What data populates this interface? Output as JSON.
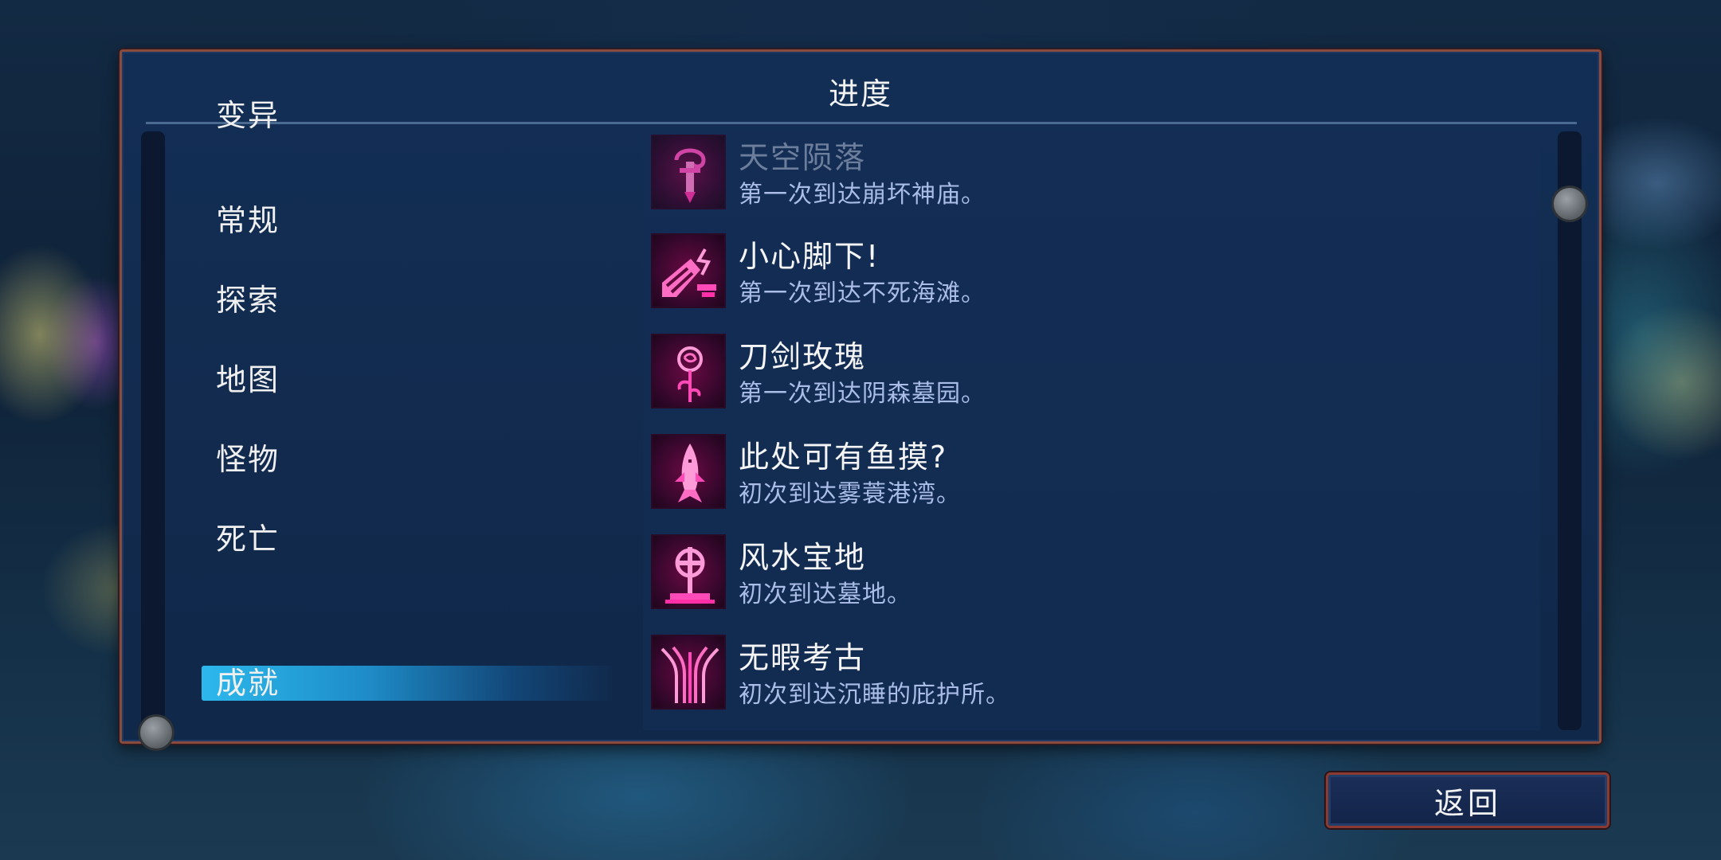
{
  "panel": {
    "title": "进度"
  },
  "menu": {
    "items": [
      {
        "label": "变异"
      },
      {
        "label": "常规"
      },
      {
        "label": "探索"
      },
      {
        "label": "地图"
      },
      {
        "label": "怪物"
      },
      {
        "label": "死亡"
      },
      {
        "label": "成就"
      }
    ],
    "selected": "成就"
  },
  "achievements": [
    {
      "title": "天空陨落",
      "description": "第一次到达崩坏神庙。",
      "icon": "falling-sword-icon"
    },
    {
      "title": "小心脚下!",
      "description": "第一次到达不死海滩。",
      "icon": "crumbling-ground-icon"
    },
    {
      "title": "刀剑玫瑰",
      "description": "第一次到达阴森墓园。",
      "icon": "rose-icon"
    },
    {
      "title": "此处可有鱼摸?",
      "description": "初次到达雾蓑港湾。",
      "icon": "shark-icon"
    },
    {
      "title": "风水宝地",
      "description": "初次到达墓地。",
      "icon": "gravestone-cross-icon"
    },
    {
      "title": "无暇考古",
      "description": "初次到达沉睡的庇护所。",
      "icon": "pillars-icon"
    }
  ],
  "buttons": {
    "back_label": "返回"
  },
  "colors": {
    "accent": "#2cb8ec",
    "icon_magenta": "#ff2fa8",
    "panel_border": "#8a4a3c"
  }
}
